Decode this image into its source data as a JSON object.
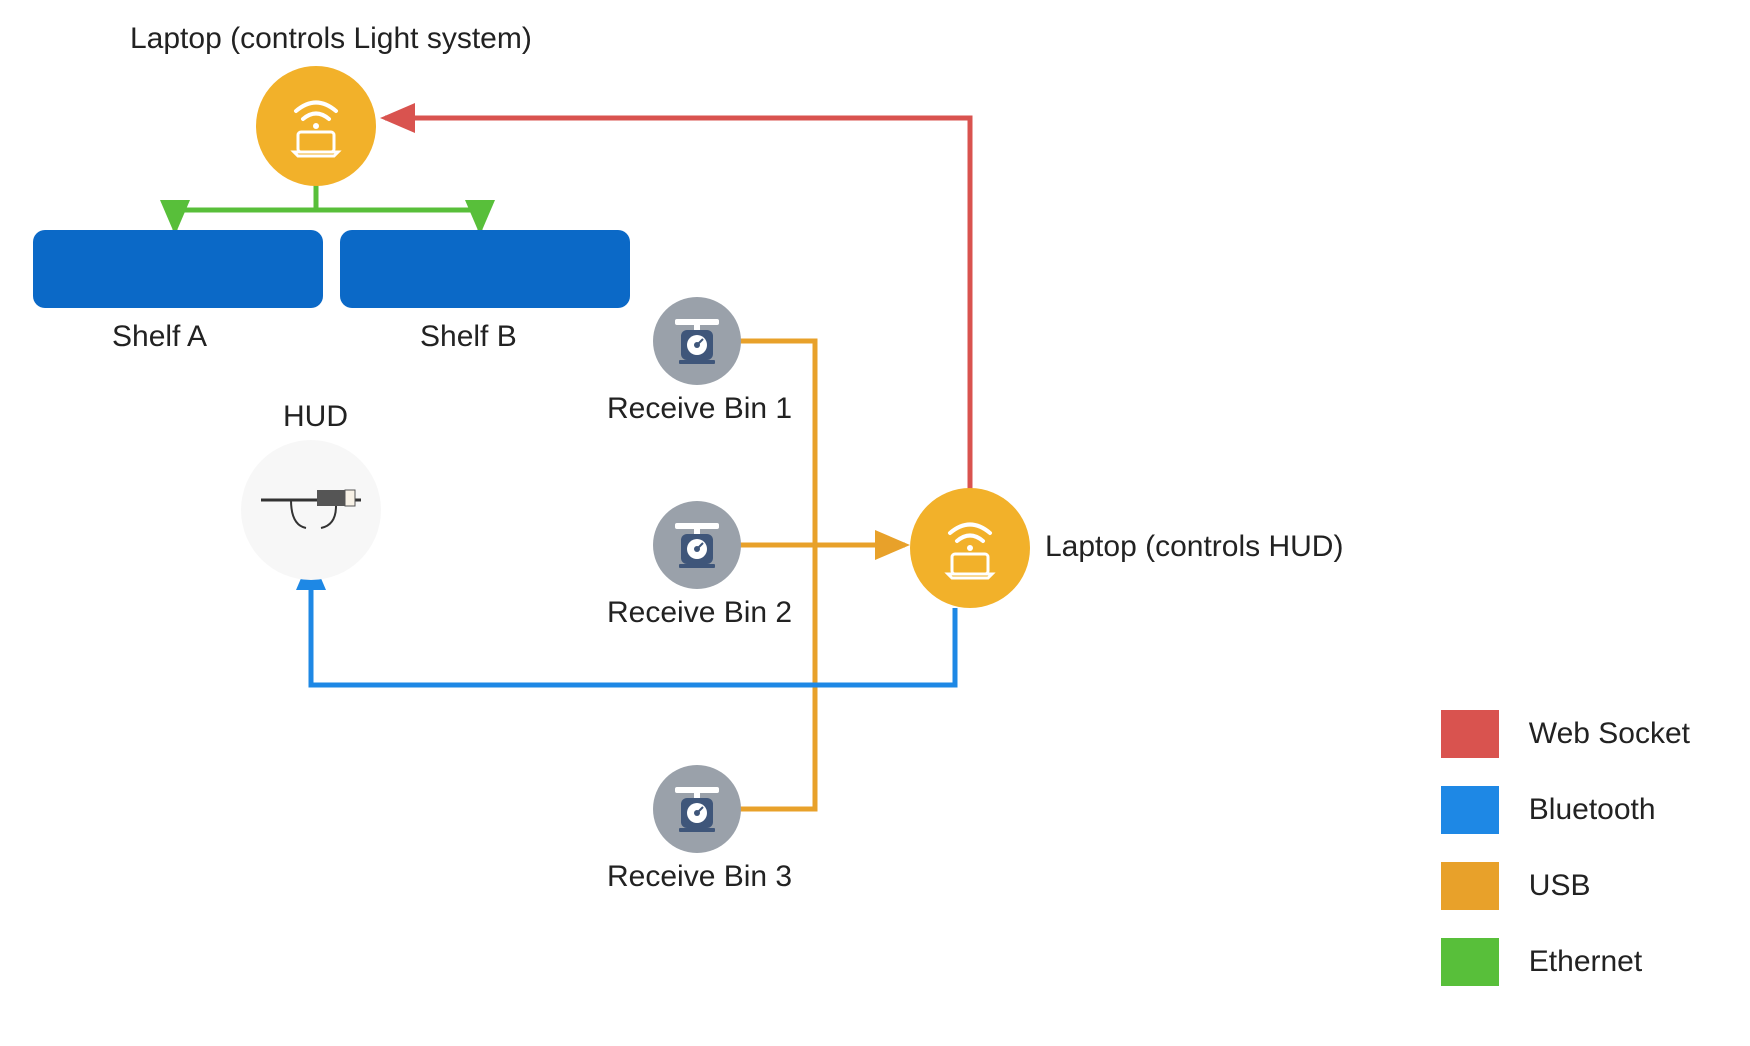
{
  "diagram": {
    "nodes": {
      "laptop_light": {
        "label": "Laptop (controls Light system)"
      },
      "laptop_hud": {
        "label": "Laptop (controls HUD)"
      },
      "hud": {
        "label": "HUD"
      },
      "shelf_a": {
        "label": "Shelf A"
      },
      "shelf_b": {
        "label": "Shelf B"
      },
      "bin1": {
        "label": "Receive Bin 1"
      },
      "bin2": {
        "label": "Receive Bin 2"
      },
      "bin3": {
        "label": "Receive Bin 3"
      }
    },
    "connections": [
      {
        "from": "laptop_hud",
        "to": "laptop_light",
        "protocol": "web_socket"
      },
      {
        "from": "laptop_light",
        "to": "shelf_a",
        "protocol": "ethernet"
      },
      {
        "from": "laptop_light",
        "to": "shelf_b",
        "protocol": "ethernet"
      },
      {
        "from": "bin1",
        "to": "laptop_hud",
        "protocol": "usb"
      },
      {
        "from": "bin2",
        "to": "laptop_hud",
        "protocol": "usb"
      },
      {
        "from": "bin3",
        "to": "laptop_hud",
        "protocol": "usb"
      },
      {
        "from": "laptop_hud",
        "to": "hud",
        "protocol": "bluetooth"
      }
    ],
    "legend": [
      {
        "id": "web_socket",
        "label": "Web Socket",
        "color": "#d9534f"
      },
      {
        "id": "bluetooth",
        "label": "Bluetooth",
        "color": "#1e88e5"
      },
      {
        "id": "usb",
        "label": "USB",
        "color": "#e8a12a"
      },
      {
        "id": "ethernet",
        "label": "Ethernet",
        "color": "#58bf3a"
      }
    ],
    "colors": {
      "laptop_node_fill": "#f2b12a",
      "laptop_inner_stroke": "#ffffff",
      "bin_node_fill": "#9aa1aa",
      "bin_scale_body": "#3f567a",
      "bin_scale_top": "#ffffff",
      "hud_node_fill": "#f7f7f7",
      "shelf_fill": "#0b69c7",
      "arrow_red": "#d9534f",
      "arrow_blue": "#1e88e5",
      "arrow_orange": "#e8a12a",
      "arrow_green": "#58bf3a"
    }
  }
}
